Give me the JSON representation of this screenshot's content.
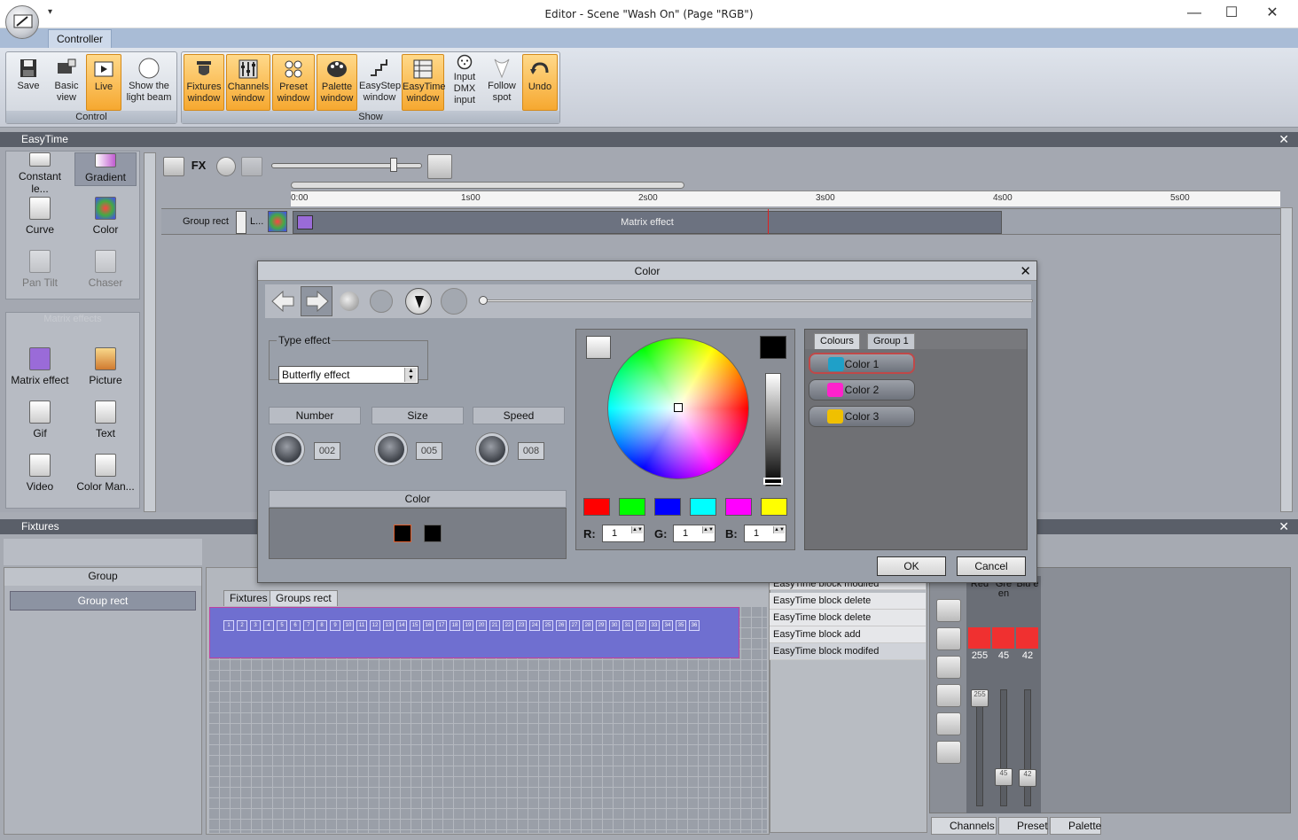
{
  "window": {
    "title": "Editor - Scene \"Wash On\" (Page \"RGB\")",
    "qat_symbol": "▾",
    "minimize": "—",
    "maximize": "☐",
    "close": "✕"
  },
  "ribbon": {
    "tab": "Controller",
    "groups": [
      {
        "label": "Control"
      },
      {
        "label": "Show"
      }
    ],
    "buttons": [
      {
        "label": "Save",
        "icon": "save-icon"
      },
      {
        "label": "Basic\nview",
        "icon": "basic-view-icon"
      },
      {
        "label": "Live",
        "icon": "live-icon"
      },
      {
        "label": "Show the\nlight beam",
        "icon": "light-beam-icon"
      },
      {
        "label": "Fixtures\nwindow",
        "icon": "fixtures-icon"
      },
      {
        "label": "Channels\nwindow",
        "icon": "channels-icon"
      },
      {
        "label": "Preset\nwindow",
        "icon": "preset-icon"
      },
      {
        "label": "Palette\nwindow",
        "icon": "palette-icon"
      },
      {
        "label": "EasyStep\nwindow",
        "icon": "easystep-icon"
      },
      {
        "label": "EasyTime\nwindow",
        "icon": "easytime-icon"
      },
      {
        "label": "Input\nDMX\ninput",
        "icon": "dmx-input-icon"
      },
      {
        "label": "Follow\nspot",
        "icon": "follow-spot-icon"
      },
      {
        "label": "Undo",
        "icon": "undo-icon"
      }
    ]
  },
  "easytime": {
    "title": "EasyTime",
    "close": "✕",
    "palette": [
      {
        "label": "Constant le...",
        "icon": "constant-level-icon"
      },
      {
        "label": "Gradient",
        "icon": "gradient-icon"
      },
      {
        "label": "Curve",
        "icon": "curve-icon"
      },
      {
        "label": "Color",
        "icon": "color-icon"
      },
      {
        "label": "Pan Tilt",
        "icon": "pan-tilt-icon"
      },
      {
        "label": "Chaser",
        "icon": "chaser-icon"
      },
      {
        "label": "Matrix effect",
        "icon": "matrix-effect-icon"
      },
      {
        "label": "Picture",
        "icon": "picture-icon"
      },
      {
        "label": "Gif",
        "icon": "gif-icon"
      },
      {
        "label": "Text",
        "icon": "text-icon"
      },
      {
        "label": "Video",
        "icon": "video-icon"
      },
      {
        "label": "Color Man...",
        "icon": "color-manager-icon"
      }
    ],
    "palette_section": "Matrix effects",
    "ruler": [
      "0:00",
      "1s00",
      "2s00",
      "3s00",
      "4s00",
      "5s00"
    ],
    "track": {
      "name": "Group rect",
      "short": "L...",
      "block": "Matrix effect"
    }
  },
  "dialog": {
    "title": "Color",
    "close": "✕",
    "type_effect_legend": "Type effect",
    "type_effect_value": "Butterfly effect",
    "params": [
      {
        "label": "Number",
        "value": "002"
      },
      {
        "label": "Size",
        "value": "005"
      },
      {
        "label": "Speed",
        "value": "008"
      }
    ],
    "color_header": "Color",
    "swatches": [
      {
        "color": "#ff0000"
      },
      {
        "color": "#00ff00"
      },
      {
        "color": "#0000ff"
      },
      {
        "color": "#00ffff"
      },
      {
        "color": "#ff00ff"
      },
      {
        "color": "#ffff00"
      }
    ],
    "rgb": [
      {
        "label": "R:",
        "value": "1"
      },
      {
        "label": "G:",
        "value": "1"
      },
      {
        "label": "B:",
        "value": "1"
      }
    ],
    "tabs": [
      "Colours",
      "Group 1"
    ],
    "colors": [
      {
        "label": "Color 1",
        "color": "#1fa0c8"
      },
      {
        "label": "Color 2",
        "color": "#ff22cc"
      },
      {
        "label": "Color 3",
        "color": "#f0c000"
      }
    ],
    "ok": "OK",
    "cancel": "Cancel"
  },
  "fixtures": {
    "title": "Fixtures",
    "close": "✕",
    "group_header": "Group",
    "group_item": "Group rect",
    "tabs": [
      "Fixtures",
      "Groups rect"
    ],
    "cells": [
      "1",
      "2",
      "3",
      "4",
      "5",
      "6",
      "7",
      "8",
      "9",
      "10",
      "11",
      "12",
      "13",
      "14",
      "15",
      "16",
      "17",
      "18",
      "19",
      "20",
      "21",
      "22",
      "23",
      "24",
      "25",
      "26",
      "27",
      "28",
      "29",
      "30",
      "31",
      "32",
      "33",
      "34",
      "35",
      "36"
    ]
  },
  "history": [
    "EasyTime block modifed",
    "EasyTime block delete",
    "EasyTime block delete",
    "EasyTime block add",
    "EasyTime block modifed"
  ],
  "channels": {
    "names": [
      "Red",
      "Gre en",
      "Blu e"
    ],
    "values": [
      "255",
      "45",
      "42"
    ],
    "fader_levels": [
      255,
      45,
      42
    ],
    "bottom_tabs": [
      "Channels",
      "Preset",
      "Palette"
    ]
  }
}
